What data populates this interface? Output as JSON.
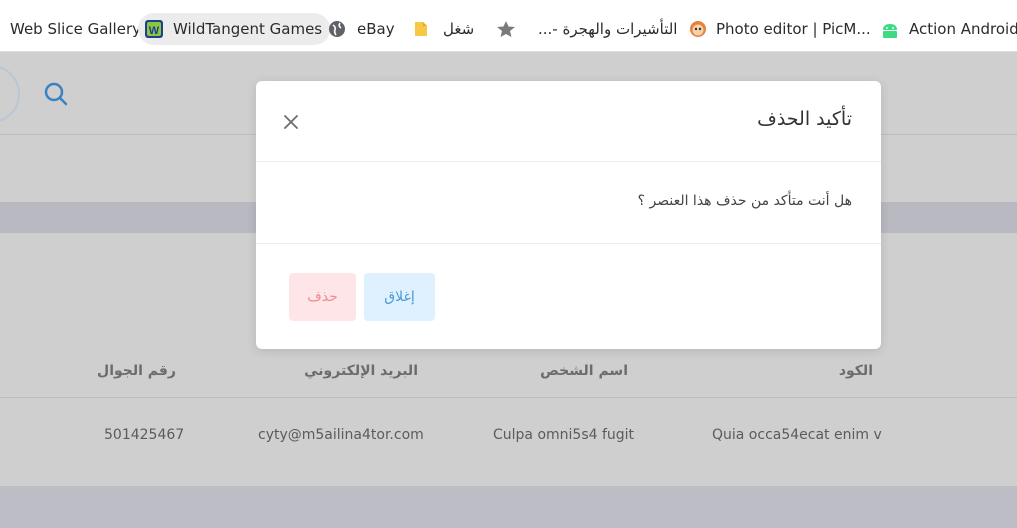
{
  "bookmarks": [
    {
      "label": "Web Slice Gallery",
      "icon": "web-slice-icon"
    },
    {
      "label": "WildTangent Games",
      "icon": "wildtangent-icon",
      "active": true
    },
    {
      "label": "eBay",
      "icon": "globe-icon"
    },
    {
      "label": "شغل",
      "icon": "folder-icon"
    },
    {
      "label": "",
      "icon": "star-icon"
    },
    {
      "label": "التأشيرات والهجرة -...",
      "icon": ""
    },
    {
      "label": "Photo editor | PicM...",
      "icon": "monkey-icon"
    },
    {
      "label": "Action Android s",
      "icon": "android-icon"
    }
  ],
  "table": {
    "headers": [
      "الكود",
      "اسم الشخص",
      "البريد الإلكتروني",
      "رقم الجوال"
    ],
    "rows": [
      [
        "Quia occa54ecat enim v",
        "Culpa omni5s4 fugit",
        "cyty@m5ailina4tor.com",
        "501425467"
      ]
    ]
  },
  "modal": {
    "title": "تأكيد الحذف",
    "message": "هل أنت متأكد من حذف هذا العنصر ؟",
    "close_label": "إغلاق",
    "delete_label": "حذف"
  },
  "colors": {
    "close_btn_bg": "#dff0fe",
    "close_btn_text": "#4a9ad8",
    "delete_btn_bg": "#fde5e8",
    "delete_btn_text": "#f08a95",
    "overlay": "#cfcfcf"
  }
}
